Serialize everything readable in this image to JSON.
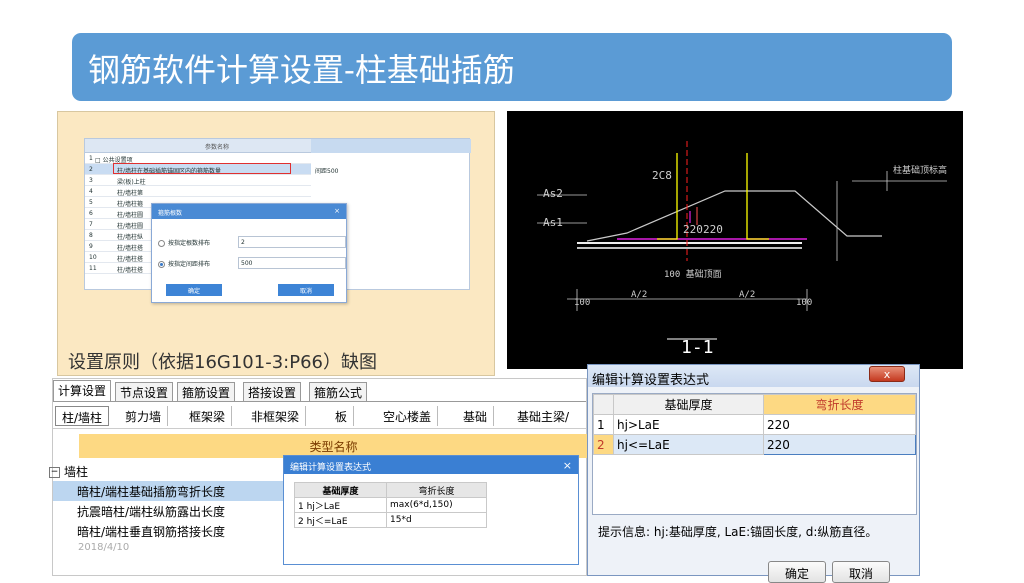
{
  "slide": {
    "title": "钢筋软件计算设置-柱基础插筋",
    "caption": "设置原则（依据16G101-3:P66）缺图",
    "date": "2018/4/10"
  },
  "screenshot1": {
    "header": "参数名称",
    "rows": [
      {
        "num": "1",
        "label": "□ 公共设置项"
      },
      {
        "num": "2",
        "label": "柱/墙柱在基础插筋锚固区内的箍筋数量"
      },
      {
        "num": "3",
        "label": "梁(板)上柱"
      },
      {
        "num": "4",
        "label": "柱/墙柱第"
      },
      {
        "num": "5",
        "label": "柱/墙柱箍"
      },
      {
        "num": "6",
        "label": "柱/墙柱圆"
      },
      {
        "num": "7",
        "label": "柱/墙柱圆"
      },
      {
        "num": "8",
        "label": "柱/墙柱纵"
      },
      {
        "num": "9",
        "label": "柱/墙柱搭"
      },
      {
        "num": "10",
        "label": "柱/墙柱搭"
      },
      {
        "num": "11",
        "label": "柱/墙柱搭"
      }
    ],
    "values": [
      "间距500",
      "1",
      "1",
      "3"
    ],
    "dialog": {
      "title": "箍筋根数",
      "option1_label": "按指定根数排布",
      "option1_value": "2",
      "option2_label": "按指定间距排布",
      "option2_value": "500",
      "ok": "确定",
      "cancel": "取消"
    }
  },
  "cad": {
    "labels": [
      "2C8",
      "As2",
      "As1",
      "220",
      "220",
      "100 基础顶面",
      "100",
      "A/2",
      "A/2",
      "100",
      "1-1",
      "柱基础顶标高"
    ]
  },
  "settings_window": {
    "tabs": [
      "计算设置",
      "节点设置",
      "箍筋设置",
      "搭接设置",
      "箍筋公式"
    ],
    "subtabs": [
      "柱/墙柱",
      "剪力墙",
      "框架梁",
      "非框架梁",
      "板",
      "空心楼盖",
      "基础",
      "基础主梁/"
    ],
    "column_header": "类型名称",
    "tree_group": "墙柱",
    "tree_items": [
      "暗柱/端柱基础插筋弯折长度",
      "抗震暗柱/端柱纵筋露出长度",
      "暗柱/端柱垂直钢筋搭接长度"
    ]
  },
  "expr_dialog_small": {
    "title": "编辑计算设置表达式",
    "headers": [
      "基础厚度",
      "弯折长度"
    ],
    "rows": [
      {
        "num": "1",
        "cond": "hj＞LaE",
        "value": "max(6*d,150)"
      },
      {
        "num": "2",
        "cond": "hj＜=LaE",
        "value": "15*d"
      }
    ]
  },
  "expr_dialog_large": {
    "title": "编辑计算设置表达式",
    "close": "x",
    "headers": [
      "基础厚度",
      "弯折长度"
    ],
    "rows": [
      {
        "num": "1",
        "cond": "hj>LaE",
        "value": "220"
      },
      {
        "num": "2",
        "cond": "hj<=LaE",
        "value": "220"
      }
    ],
    "hint": "提示信息: hj:基础厚度, LaE:锚固长度, d:纵筋直径。",
    "ok": "确定",
    "cancel": "取消"
  },
  "colors": {
    "title_bg": "#5b9bd5",
    "panel_bg": "#fbe8c2",
    "header_yellow": "#fdd983",
    "dialog_blue": "#3a7fd3"
  }
}
